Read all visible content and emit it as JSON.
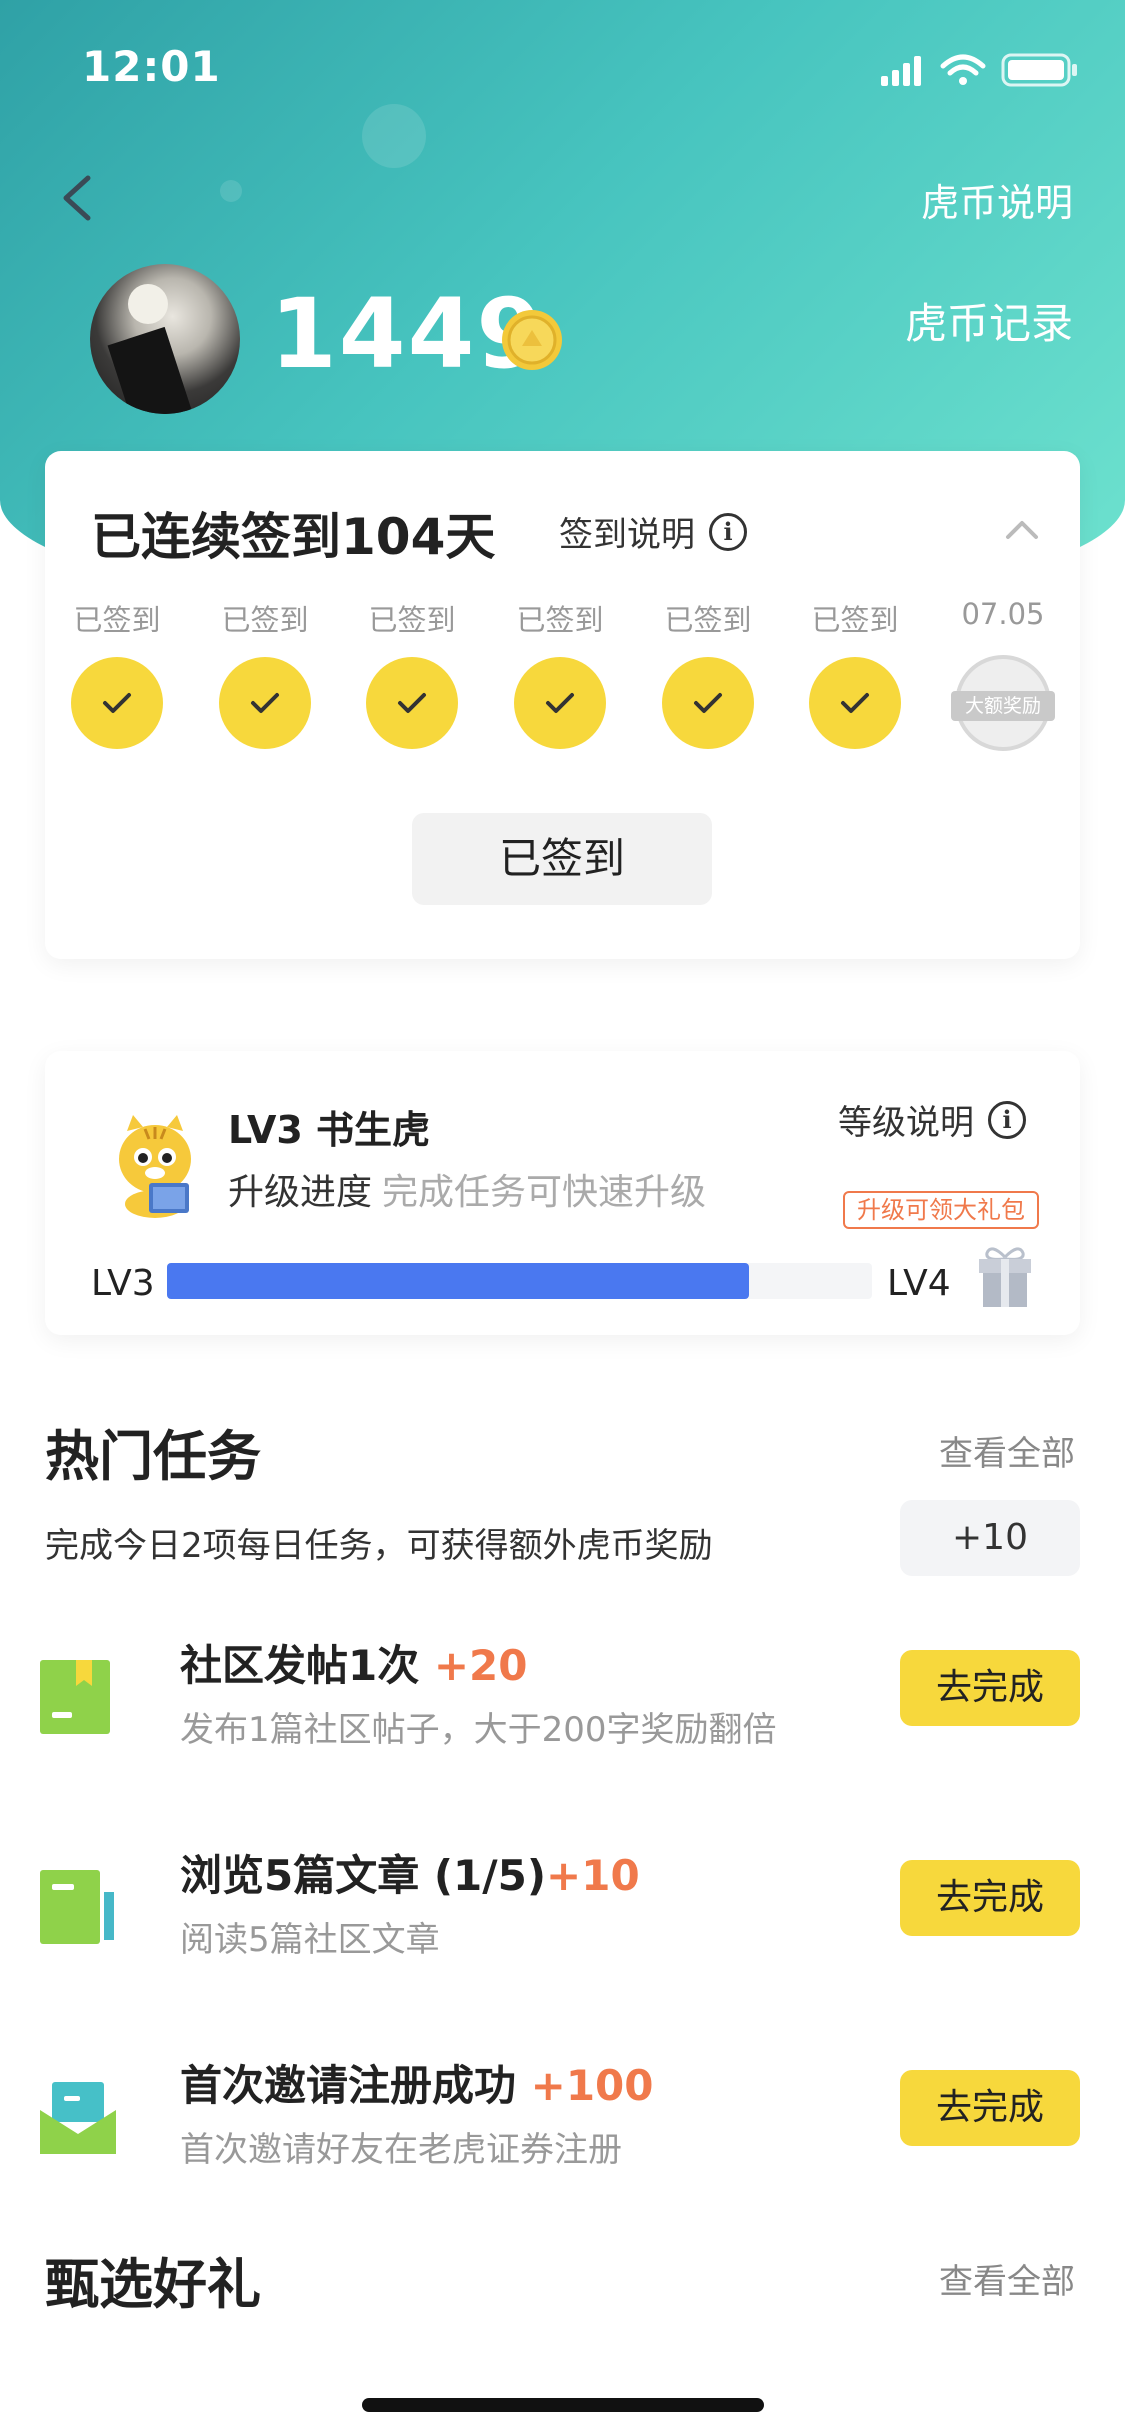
{
  "status_bar": {
    "time": "12:01"
  },
  "header": {
    "coin_rules_link": "虎币说明",
    "coin_records_link": "虎币记录",
    "coin_balance": "1449"
  },
  "checkin": {
    "title": "已连续签到104天",
    "help_label": "签到说明",
    "days": [
      {
        "label": "已签到",
        "checked": true
      },
      {
        "label": "已签到",
        "checked": true
      },
      {
        "label": "已签到",
        "checked": true
      },
      {
        "label": "已签到",
        "checked": true
      },
      {
        "label": "已签到",
        "checked": true
      },
      {
        "label": "已签到",
        "checked": true
      },
      {
        "label": "07.05",
        "checked": false,
        "badge": "大额奖励"
      }
    ],
    "button_label": "已签到"
  },
  "level": {
    "title": "LV3 书生虎",
    "progress_label": "升级进度",
    "progress_hint": "完成任务可快速升级",
    "help_label": "等级说明",
    "from_level": "LV3",
    "to_level": "LV4",
    "progress_fraction": 0.825,
    "gift_tip": "升级可领大礼包"
  },
  "hot_tasks": {
    "title": "热门任务",
    "view_all": "查看全部",
    "daily_bonus_text": "完成今日2项每日任务，可获得额外虎币奖励",
    "daily_bonus_value": "+10",
    "tasks": [
      {
        "name": "社区发帖1次",
        "reward": "+20",
        "desc": "发布1篇社区帖子，大于200字奖励翻倍",
        "button": "去完成"
      },
      {
        "name": "浏览5篇文章 (1/5)",
        "reward": "+10",
        "desc": "阅读5篇社区文章",
        "button": "去完成"
      },
      {
        "name": "首次邀请注册成功",
        "reward": "+100",
        "desc": "首次邀请好友在老虎证券注册",
        "button": "去完成"
      }
    ]
  },
  "gifts": {
    "title": "甄选好礼",
    "view_all": "查看全部"
  },
  "colors": {
    "accent_yellow": "#f7d83c",
    "reward_orange": "#f0794b",
    "progress_blue": "#4a78f0",
    "header_teal": "#47c4bf"
  }
}
